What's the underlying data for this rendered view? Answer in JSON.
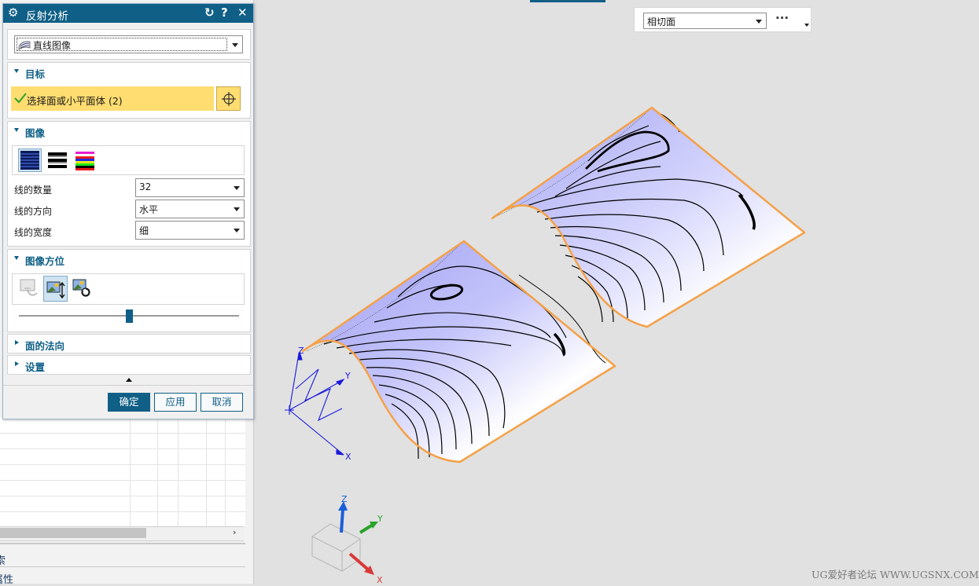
{
  "dialog": {
    "title": "反射分析",
    "image_type": {
      "selected": "直线图像"
    },
    "target": {
      "header": "目标",
      "selection_label": "选择面或小平面体 (2)"
    },
    "image": {
      "header": "图像",
      "line_count": {
        "label": "线的数量",
        "value": "32"
      },
      "line_direction": {
        "label": "线的方向",
        "value": "水平"
      },
      "line_width": {
        "label": "线的宽度",
        "value": "细"
      }
    },
    "image_orientation": {
      "header": "图像方位",
      "slider_position": 0.5
    },
    "face_normal": {
      "header": "面的法向"
    },
    "settings": {
      "header": "设置"
    },
    "buttons": {
      "ok": "确定",
      "apply": "应用",
      "cancel": "取消"
    }
  },
  "selection_bar": {
    "filter": "相切面",
    "more": "···"
  },
  "host_panel": {
    "label1": "索",
    "label2": "属性"
  },
  "viewport": {
    "axis_labels": {
      "z": "Z",
      "y": "Y",
      "x": "X"
    },
    "triad_labels": {
      "z": "Z",
      "y": "Y",
      "x": "X"
    },
    "watermark": "UG爱好者论坛 WWW.UGSNX.COM"
  },
  "colors": {
    "accent": "#0f5f86",
    "highlight": "#ffdd71",
    "surface": "#b9b9f5",
    "edge": "#f5a146"
  }
}
